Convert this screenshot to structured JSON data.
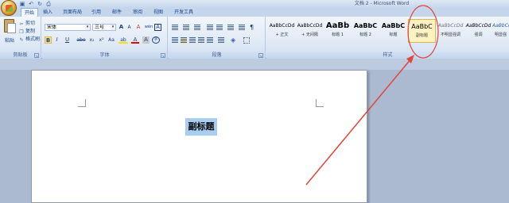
{
  "window": {
    "title": "文档 2 - Microsoft Word"
  },
  "quick_access": [
    {
      "name": "save-icon",
      "glyph": "▣"
    },
    {
      "name": "undo-icon",
      "glyph": "↶"
    },
    {
      "name": "redo-icon",
      "glyph": "↻"
    },
    {
      "name": "print-preview-icon",
      "glyph": "⎙"
    }
  ],
  "tabs": [
    "开始",
    "插入",
    "页面布局",
    "引用",
    "邮件",
    "审阅",
    "视图",
    "开发工具"
  ],
  "clipboard": {
    "paste_label": "粘贴",
    "cut_label": "剪切",
    "copy_label": "复制",
    "format_painter_label": "格式刷",
    "group_label": "剪贴板"
  },
  "font": {
    "font_name": "宋体",
    "font_size": "三号",
    "grow_label": "A",
    "shrink_label": "A",
    "clear_label": "A",
    "phonetic_label": "wén",
    "charborder_label": "A",
    "bold": "B",
    "italic": "I",
    "underline": "U",
    "strike": "abe",
    "subscript": "x₂",
    "superscript": "x²",
    "case_label": "Aa",
    "highlight_label": "ab",
    "color_label": "A",
    "shade_label": "A",
    "circle_label": "字",
    "group_label": "字体"
  },
  "paragraph": {
    "group_label": "段落"
  },
  "styles": {
    "items": [
      {
        "preview": "AaBbCcDd",
        "name": "+ 正文"
      },
      {
        "preview": "AaBbCcDd",
        "name": "+ 无间隔"
      },
      {
        "preview": "AaBb",
        "name": "标题 1"
      },
      {
        "preview": "AaBbC",
        "name": "标题 2"
      },
      {
        "preview": "AaBbC",
        "name": "标题"
      },
      {
        "preview": "AaBbC",
        "name": "副标题"
      },
      {
        "preview": "AaBbCcDd",
        "name": "不明显强调"
      },
      {
        "preview": "AaBbCcDd",
        "name": "强调"
      },
      {
        "preview": "AaBbCcDd",
        "name": "明显强"
      }
    ],
    "group_label": "样式"
  },
  "document": {
    "heading_text": "副标题"
  },
  "colors": {
    "annotation": "#e0453a",
    "selection": "#a8cdf0"
  }
}
